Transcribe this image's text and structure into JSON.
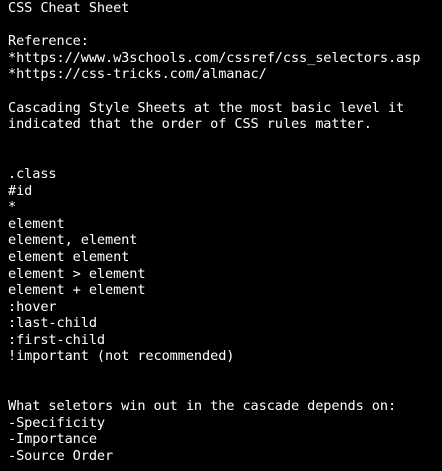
{
  "content": {
    "lines": [
      "CSS Cheat Sheet",
      "",
      "Reference:",
      "*https://www.w3schools.com/cssref/css_selectors.asp",
      "*https://css-tricks.com/almanac/",
      "",
      "Cascading Style Sheets at the most basic level it",
      "indicated that the order of CSS rules matter.",
      "",
      "",
      ".class",
      "#id",
      "*",
      "element",
      "element, element",
      "element element",
      "element > element",
      "element + element",
      ":hover",
      ":last-child",
      ":first-child",
      "!important (not recommended)",
      "",
      "",
      "What seletors win out in the cascade depends on:",
      "-Specificity",
      "-Importance",
      "-Source Order"
    ]
  }
}
